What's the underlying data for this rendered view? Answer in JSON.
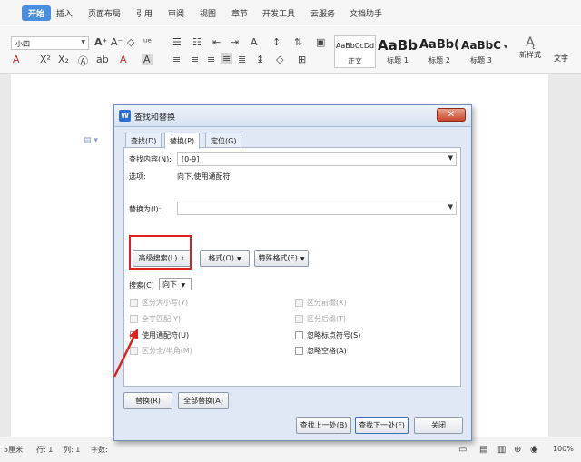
{
  "menubar": {
    "tabs": [
      "开始",
      "插入",
      "页面布局",
      "引用",
      "审阅",
      "视图",
      "章节",
      "开发工具",
      "云服务",
      "文档助手"
    ]
  },
  "ribbon": {
    "font_size": "小四",
    "styles": [
      {
        "sample": "AaBbCcDd",
        "label": "正文"
      },
      {
        "sample": "AaBb",
        "label": "标题 1"
      },
      {
        "sample": "AaBb(",
        "label": "标题 2"
      },
      {
        "sample": "AaBbC",
        "label": "标题 3"
      }
    ],
    "new_style": "新样式",
    "text_tool": "文字"
  },
  "statusbar": {
    "unit": "5厘米",
    "row": "行: 1",
    "col": "列: 1",
    "word_count": "字数:",
    "zoom": "100%"
  },
  "dialog": {
    "title": "查找和替换",
    "close": "✕",
    "tabs": [
      "查找(D)",
      "替换(P)",
      "定位(G)"
    ],
    "find_label": "查找内容(N):",
    "find_value": "[0-9]",
    "options_label": "选项:",
    "options_value": "向下,使用通配符",
    "replace_label": "替换为(I):",
    "replace_value": "",
    "advanced_button": "高级搜索(L)",
    "format_button": "格式(O)",
    "special_button": "特殊格式(E)",
    "search_label": "搜索(C)",
    "search_value": "向下",
    "opts_left": [
      {
        "label": "区分大小写(Y)",
        "enabled": false,
        "checked": false
      },
      {
        "label": "全字匹配(Y)",
        "enabled": false,
        "checked": false
      },
      {
        "label": "使用通配符(U)",
        "enabled": true,
        "checked": true
      },
      {
        "label": "区分全/半角(M)",
        "enabled": false,
        "checked": false
      }
    ],
    "opts_right": [
      {
        "label": "区分前缀(X)",
        "enabled": false,
        "checked": false
      },
      {
        "label": "区分后缀(T)",
        "enabled": false,
        "checked": false
      },
      {
        "label": "忽略标点符号(S)",
        "enabled": true,
        "checked": false
      },
      {
        "label": "忽略空格(A)",
        "enabled": true,
        "checked": false
      }
    ],
    "replace_button": "替换(R)",
    "replace_all_button": "全部替换(A)",
    "find_prev_button": "查找上一处(B)",
    "find_next_button": "查找下一处(F)",
    "close_button": "关闭"
  },
  "annotation_color": "#e02020"
}
